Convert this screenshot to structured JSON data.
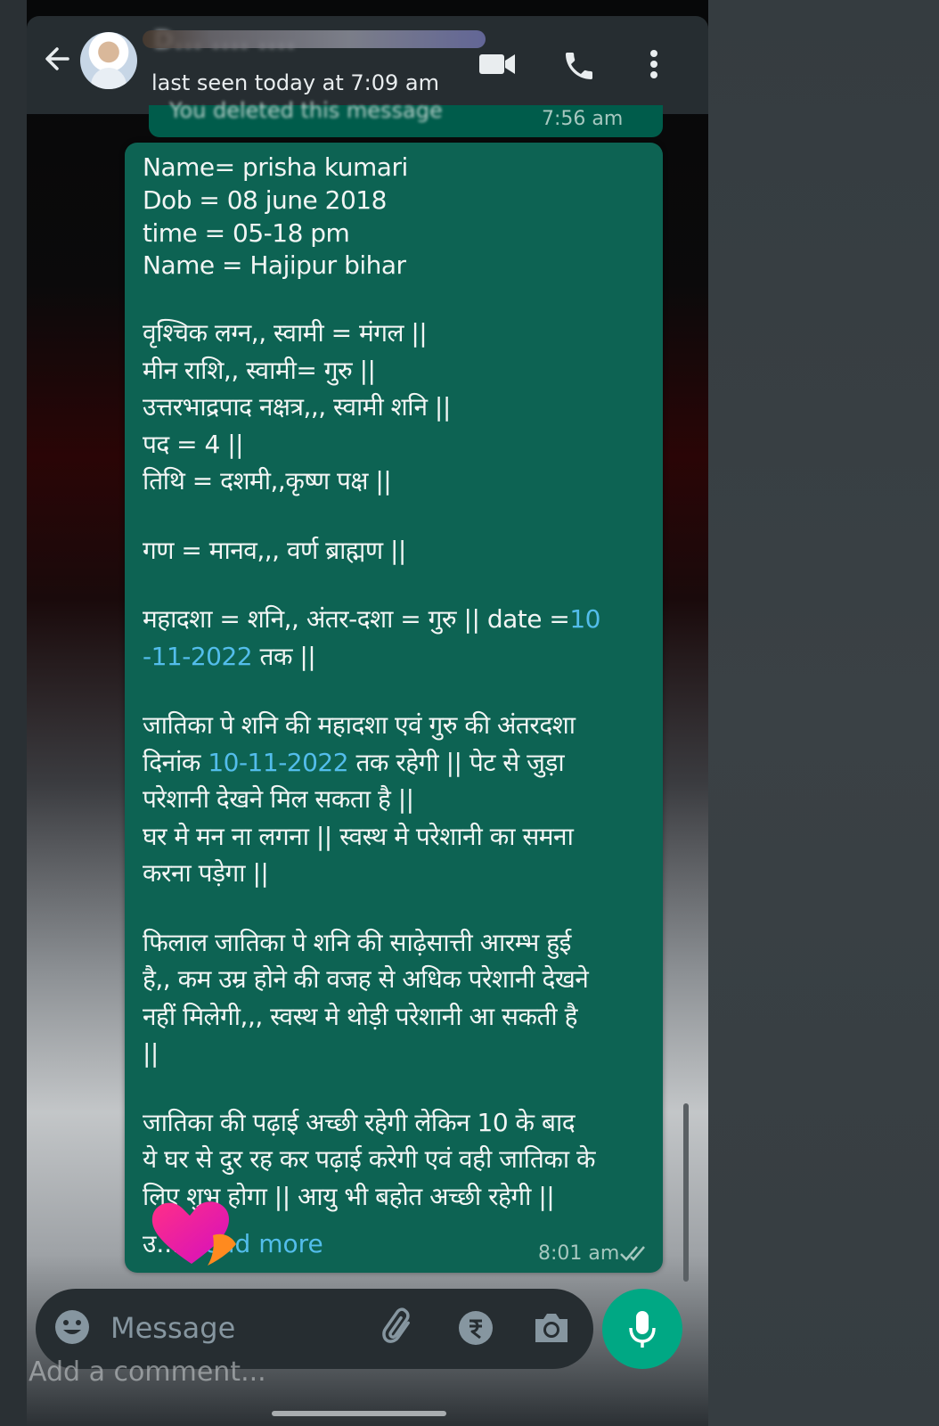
{
  "header": {
    "contact_name": "D... .... ....",
    "last_seen": "last seen today at 7:09 am"
  },
  "deleted_message": {
    "text": "You deleted this message",
    "time": "7:56 am"
  },
  "message": {
    "lines_top": [
      "Name=  prisha kumari",
      " Dob = 08 june 2018",
      "time = 05-18 pm",
      "Name = Hajipur bihar"
    ],
    "lines_hindi_1": [
      "वृश्चिक लग्न,, स्वामी = मंगल ||",
      "मीन राशि,, स्वामी=  गुरु ||",
      "उत्तरभाद्रपाद नक्षत्र,,, स्वामी शनि ||",
      "पद = 4 ||",
      "तिथि = दशमी,,कृष्ण पक्ष ||"
    ],
    "line_gan": "गण = मानव,,, वर्ण ब्राह्मण ||",
    "mahadasha_prefix": "महादशा = शनि,, अंतर-दशा = गुरु || date =",
    "mahadasha_date_a": "10",
    "mahadasha_date_b": "-11-2022",
    "mahadasha_suffix": " तक ||",
    "para1_line1": "जातिका पे शनि की महादशा एवं गुरु की अंतरदशा",
    "para1_line2_prefix": "दिनांक ",
    "para1_line2_date": "10-11-2022",
    "para1_line2_suffix": " तक रहेगी || पेट से जुड़ा",
    "para1_rest": [
      "परेशानी देखने मिल सकता है ||",
      "घर मे मन ना लगना || स्वस्थ मे परेशानी का समना",
      "करना पड़ेगा ||"
    ],
    "para2": [
      "फिलाल जातिका पे शनि की साढ़ेसात्ती आरम्भ हुई",
      "है,, कम उम्र होने की वजह से अधिक परेशानी देखने",
      "नहीं मिलेगी,,, स्वस्थ मे थोड़ी परेशानी  आ सकती है",
      "||"
    ],
    "para3": [
      "जातिका की पढ़ाई अच्छी रहेगी लेकिन 10 के बाद",
      "ये घर से दुर रह कर पढ़ाई करेगी एवं वही जातिका के",
      "लिए शुभ होगा || आयु भी बहोत अच्छी रहेगी ||"
    ],
    "read_more_prefix": "उ... ",
    "read_more": "Read more",
    "time": "8:01 am"
  },
  "input": {
    "placeholder": "Message"
  },
  "overlay": {
    "add_comment": "Add a comment..."
  },
  "colors": {
    "bubble": "#0d6353",
    "link": "#53bdeb",
    "mic_button": "#00a884",
    "header": "#262d31"
  },
  "icons": [
    "back-arrow-icon",
    "video-call-icon",
    "phone-icon",
    "more-options-icon",
    "emoji-icon",
    "attach-icon",
    "rupee-icon",
    "camera-icon",
    "mic-icon",
    "double-tick-icon",
    "heart-icon"
  ]
}
